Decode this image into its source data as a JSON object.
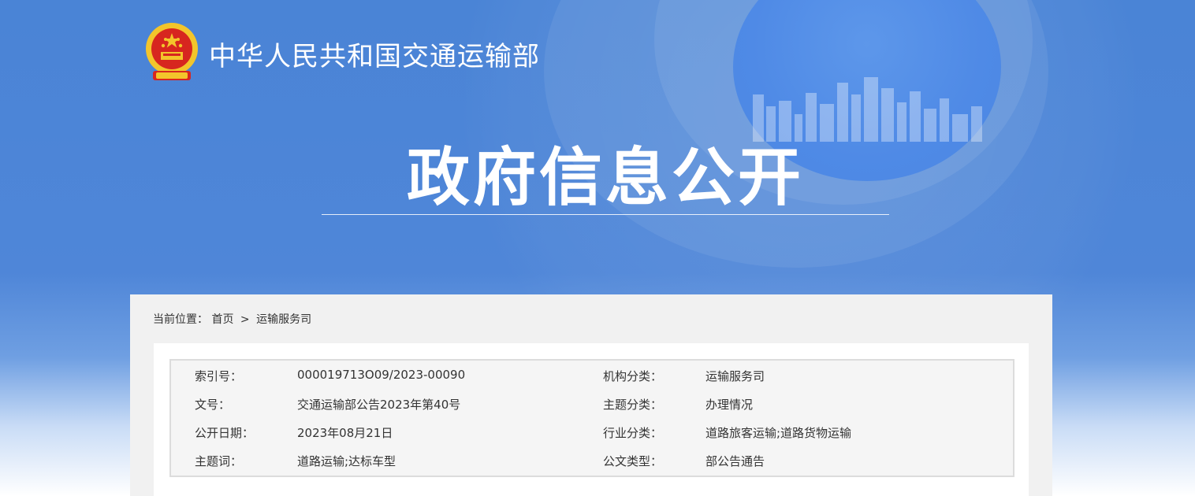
{
  "header": {
    "site_title": "中华人民共和国交通运输部",
    "page_title": "政府信息公开"
  },
  "breadcrumb": {
    "prefix": "当前位置：",
    "items": [
      "首页",
      "运输服务司"
    ],
    "separator": ">"
  },
  "metadata": [
    {
      "left_key": "索引号：",
      "left_value": "000019713O09/2023-00090",
      "right_key": "机构分类：",
      "right_value": "运输服务司"
    },
    {
      "left_key": "文号：",
      "left_value": "交通运输部公告2023年第40号",
      "right_key": "主题分类：",
      "right_value": "办理情况"
    },
    {
      "left_key": "公开日期：",
      "left_value": "2023年08月21日",
      "right_key": "行业分类：",
      "right_value": "道路旅客运输;道路货物运输"
    },
    {
      "left_key": "主题词：",
      "left_value": "道路运输;达标车型",
      "right_key": "公文类型：",
      "right_value": "部公告通告"
    }
  ],
  "colors": {
    "banner_blue": "#4a84d6",
    "emblem_red": "#d7261f",
    "emblem_gold": "#f3c52b"
  },
  "icons": {
    "emblem": "national-emblem-icon"
  }
}
